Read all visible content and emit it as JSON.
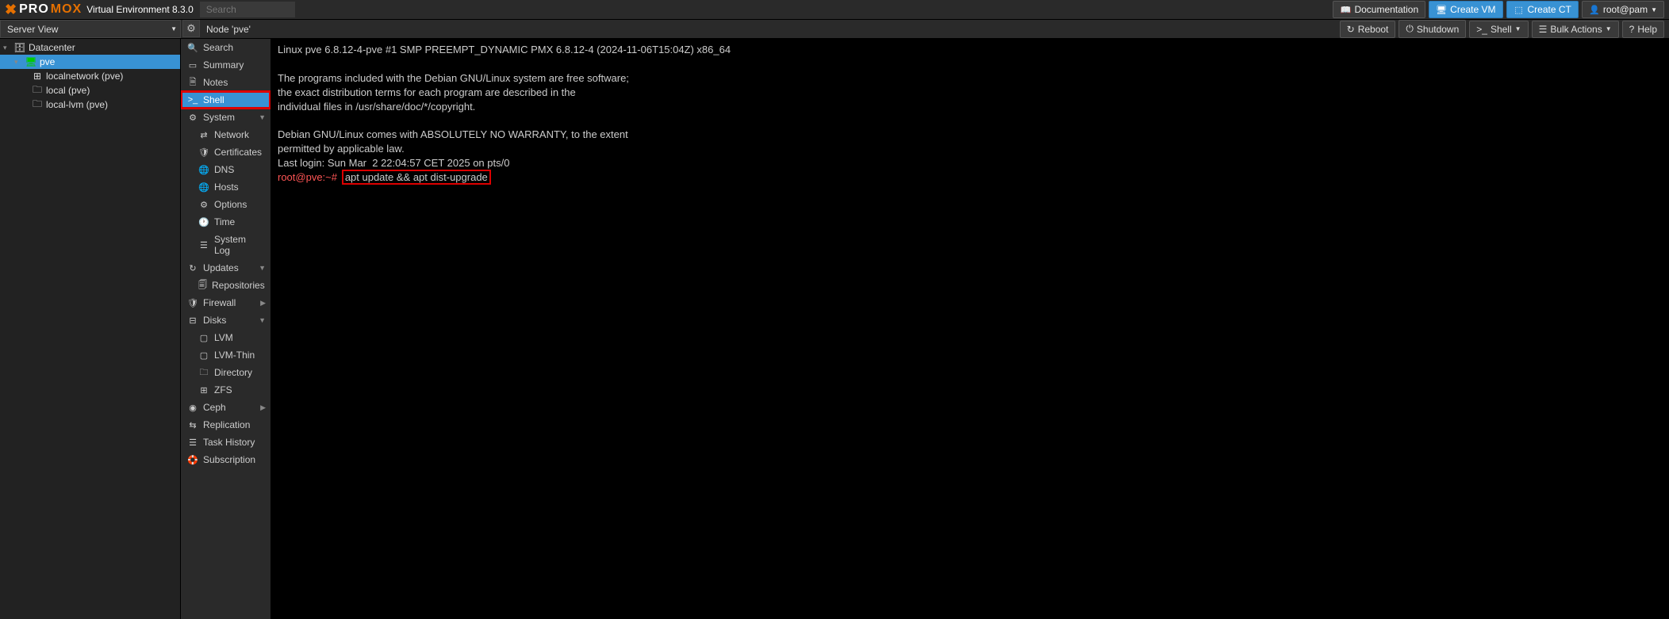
{
  "topbar": {
    "logo_pro": "PRO",
    "logo_mox": "MOX",
    "env": "Virtual Environment 8.3.0",
    "search_placeholder": "Search",
    "doc": "Documentation",
    "create_vm": "Create VM",
    "create_ct": "Create CT",
    "user": "root@pam"
  },
  "row2": {
    "server_view": "Server View",
    "node_label": "Node 'pve'",
    "reboot": "Reboot",
    "shutdown": "Shutdown",
    "shell": "Shell",
    "bulk": "Bulk Actions",
    "help": "Help"
  },
  "tree": {
    "datacenter": "Datacenter",
    "pve": "pve",
    "localnetwork": "localnetwork (pve)",
    "local": "local (pve)",
    "locallvm": "local-lvm (pve)"
  },
  "menu": {
    "search": "Search",
    "summary": "Summary",
    "notes": "Notes",
    "shell": "Shell",
    "system": "System",
    "network": "Network",
    "certificates": "Certificates",
    "dns": "DNS",
    "hosts": "Hosts",
    "options": "Options",
    "time": "Time",
    "syslog": "System Log",
    "updates": "Updates",
    "repositories": "Repositories",
    "firewall": "Firewall",
    "disks": "Disks",
    "lvm": "LVM",
    "lvmthin": "LVM-Thin",
    "directory": "Directory",
    "zfs": "ZFS",
    "ceph": "Ceph",
    "replication": "Replication",
    "taskhistory": "Task History",
    "subscription": "Subscription"
  },
  "terminal": {
    "line1": "Linux pve 6.8.12-4-pve #1 SMP PREEMPT_DYNAMIC PMX 6.8.12-4 (2024-11-06T15:04Z) x86_64",
    "line2": "",
    "line3": "The programs included with the Debian GNU/Linux system are free software;",
    "line4": "the exact distribution terms for each program are described in the",
    "line5": "individual files in /usr/share/doc/*/copyright.",
    "line6": "",
    "line7": "Debian GNU/Linux comes with ABSOLUTELY NO WARRANTY, to the extent",
    "line8": "permitted by applicable law.",
    "line9": "Last login: Sun Mar  2 22:04:57 CET 2025 on pts/0",
    "prompt": "root@pve:~#",
    "command": "apt update && apt dist-upgrade"
  }
}
